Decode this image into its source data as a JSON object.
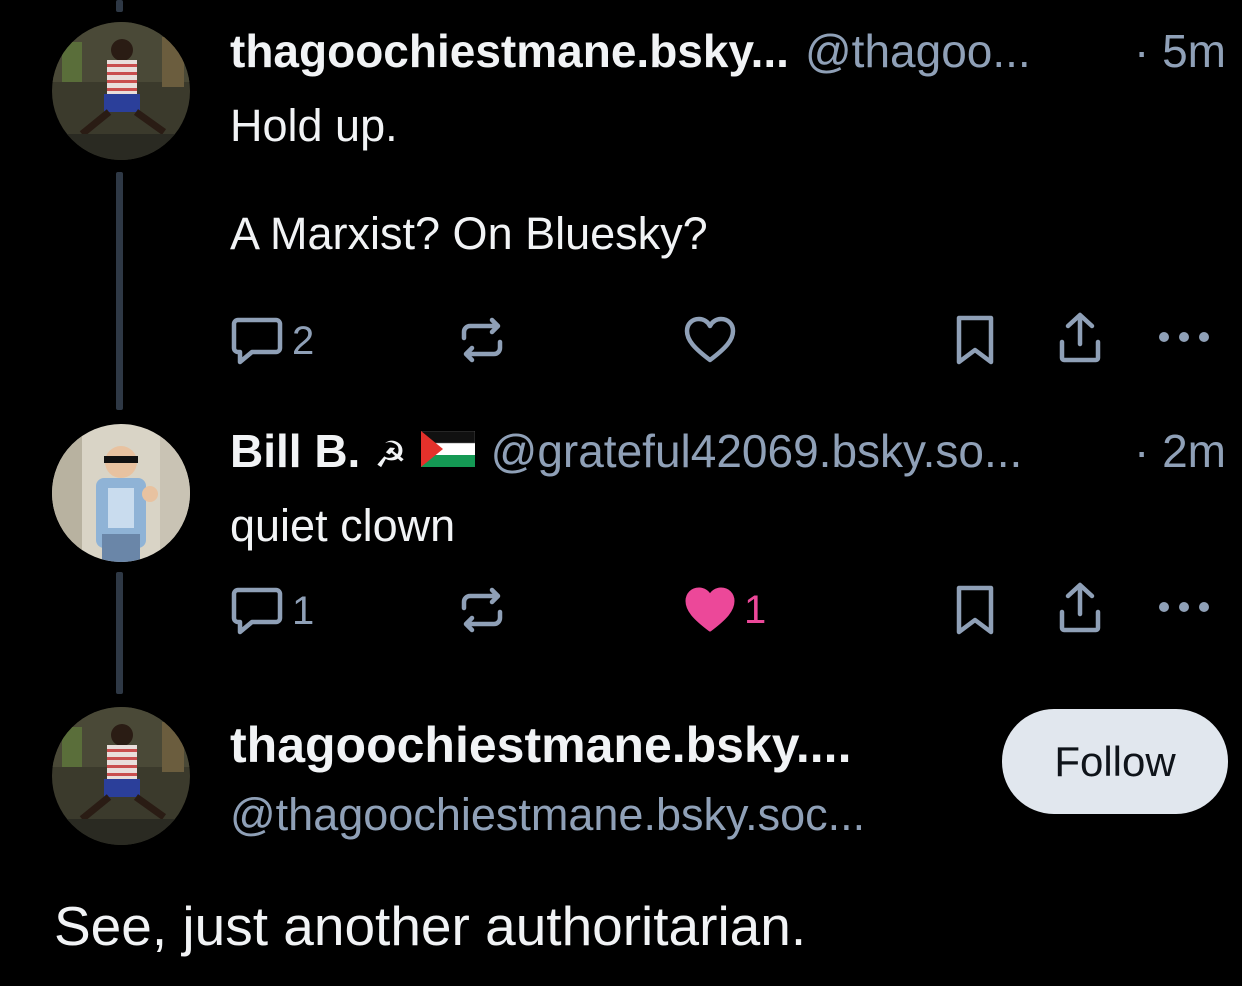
{
  "posts": [
    {
      "name": "thagoochiestmane.bsky...",
      "handle": "@thagoo...",
      "time": "· 5m",
      "body": "Hold up.\n\nA Marxist? On Bluesky?",
      "replies": "2",
      "reposts": "",
      "likes": "",
      "liked": false
    },
    {
      "name": "Bill B.",
      "name_emoji": "☭",
      "handle": "@grateful42069.bsky.so...",
      "time": "· 2m",
      "body": "quiet clown",
      "replies": "1",
      "reposts": "",
      "likes": "1",
      "liked": true
    }
  ],
  "focus_post": {
    "name": "thagoochiestmane.bsky....",
    "handle": "@thagoochiestmane.bsky.soc...",
    "follow_label": "Follow",
    "text": "See, just another authoritarian."
  },
  "colors": {
    "background": "#000000",
    "text": "#f1f3f5",
    "muted": "#8fa0b7",
    "like": "#ec4899",
    "thread_line": "#2e3845",
    "follow_bg": "#e1e7ee"
  },
  "icons": [
    "reply-icon",
    "repost-icon",
    "like-icon",
    "bookmark-icon",
    "share-icon",
    "more-icon"
  ]
}
